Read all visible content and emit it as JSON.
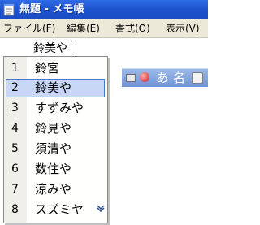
{
  "window": {
    "title": "無題 - メモ帳"
  },
  "menu": {
    "items": [
      "ファイル(F)",
      "編集(E)",
      "書式(O)",
      "表示(V)"
    ]
  },
  "editor": {
    "composition_text": "鈴美や"
  },
  "ime_toolbar": {
    "mode_char": "あ",
    "mode2_char": "名"
  },
  "candidates": {
    "selected_index": 2,
    "items": [
      {
        "number": "1",
        "text": "鈴宮"
      },
      {
        "number": "2",
        "text": "鈴美や"
      },
      {
        "number": "3",
        "text": "すずみや"
      },
      {
        "number": "4",
        "text": "鈴見や"
      },
      {
        "number": "5",
        "text": "須清や"
      },
      {
        "number": "6",
        "text": "数住や"
      },
      {
        "number": "7",
        "text": "涼みや"
      },
      {
        "number": "8",
        "text": "スズミヤ"
      }
    ]
  },
  "colors": {
    "titlebar": "#1f55d0",
    "menubar": "#ece9d8",
    "selection": "#c7d7f5"
  }
}
